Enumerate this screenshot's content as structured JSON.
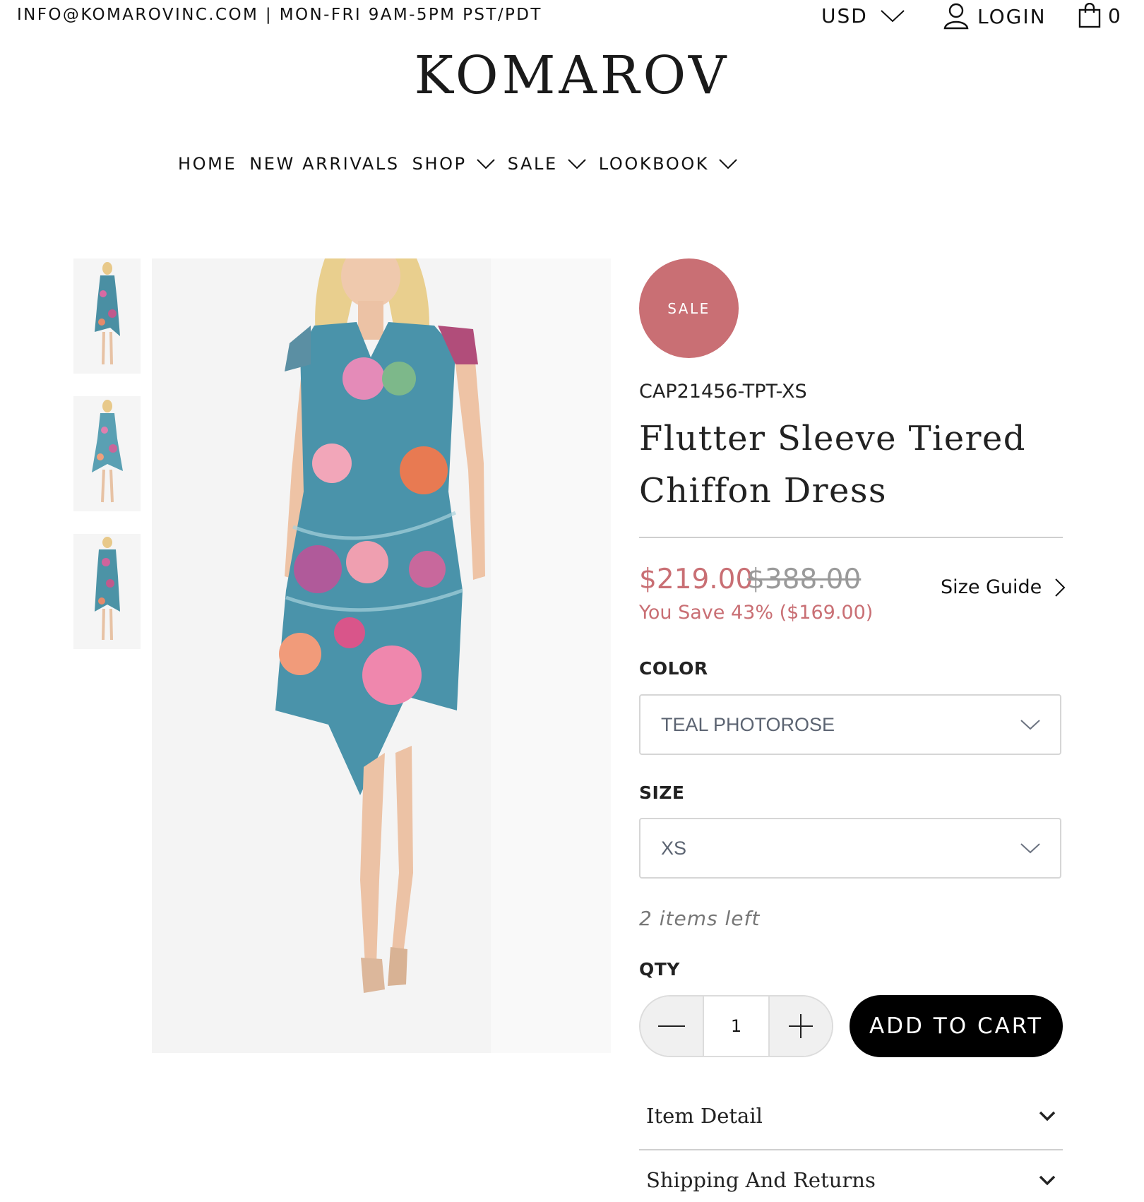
{
  "topbar": {
    "contact": "INFO@KOMAROVINC.COM | MON-FRI 9AM-5PM PST/PDT",
    "currency": "USD",
    "login": "LOGIN",
    "cart_count": "0"
  },
  "brand": {
    "logo": "KOMAROV"
  },
  "nav": {
    "items": [
      {
        "label": "HOME"
      },
      {
        "label": "NEW ARRIVALS"
      },
      {
        "label": "SHOP"
      },
      {
        "label": "SALE"
      },
      {
        "label": "LOOKBOOK"
      }
    ]
  },
  "gallery": {
    "thumbnail_count": 3
  },
  "product": {
    "badge": "SALE",
    "sku": "CAP21456-TPT-XS",
    "title": "Flutter Sleeve Tiered Chiffon Dress",
    "price": "$219.00",
    "compare_price": "$388.00",
    "savings": "You Save 43% ($169.00)",
    "size_guide": "Size Guide",
    "color_label": "COLOR",
    "color_value": "TEAL PHOTOROSE",
    "size_label": "SIZE",
    "size_value": "XS",
    "stock": "2 items left",
    "qty_label": "QTY",
    "qty_value": "1",
    "add_to_cart": "ADD TO CART"
  },
  "accordions": [
    {
      "label": "Item Detail"
    },
    {
      "label": "Shipping And Returns"
    }
  ],
  "colors": {
    "accent": "#c96f74",
    "button": "#000000"
  }
}
